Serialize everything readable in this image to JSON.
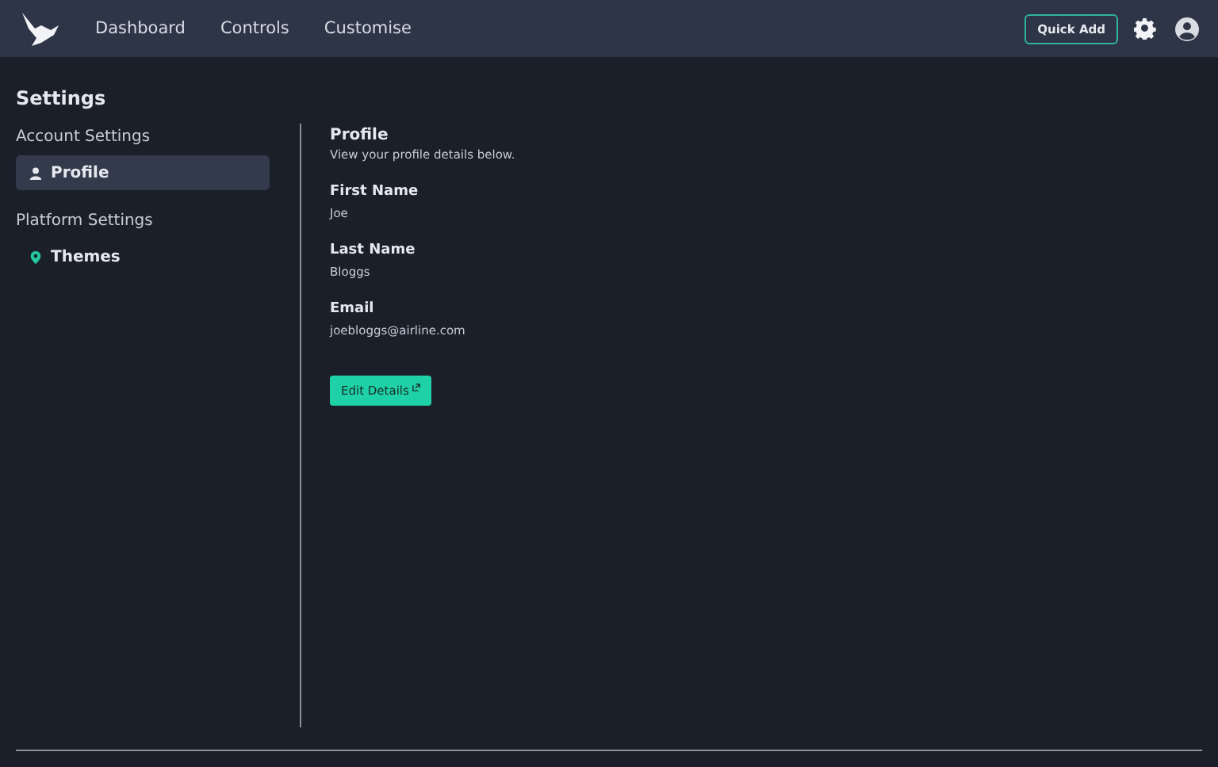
{
  "nav": {
    "links": [
      {
        "label": "Dashboard"
      },
      {
        "label": "Controls"
      },
      {
        "label": "Customise"
      }
    ],
    "quick_add": "Quick Add"
  },
  "page_title": "Settings",
  "sidebar": {
    "groups": [
      {
        "heading": "Account Settings",
        "items": [
          {
            "label": "Profile",
            "kind": "person",
            "selected": true
          }
        ]
      },
      {
        "heading": "Platform Settings",
        "items": [
          {
            "label": "Themes",
            "kind": "pin",
            "selected": false
          }
        ]
      }
    ]
  },
  "profile": {
    "title": "Profile",
    "subtitle": "View your profile details below.",
    "fields": [
      {
        "label": "First Name",
        "value": "Joe"
      },
      {
        "label": "Last Name",
        "value": "Bloggs"
      },
      {
        "label": "Email",
        "value": "joebloggs@airline.com"
      }
    ],
    "button": "Edit Details"
  }
}
